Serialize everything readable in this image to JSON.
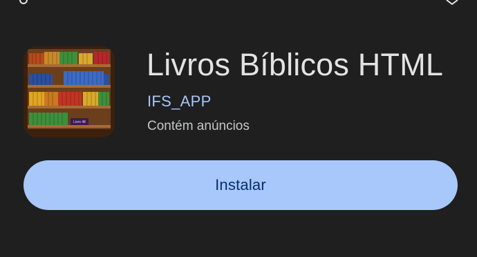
{
  "app": {
    "title": "Livros Bíblicos HTML",
    "developer": "IFS_APP",
    "ads_notice": "Contém anúncios",
    "icon_badge": "Livro 48"
  },
  "actions": {
    "install_label": "Instalar"
  },
  "colors": {
    "background": "#1f1f1f",
    "title_text": "#e3e3e3",
    "developer_link": "#a8c7fa",
    "secondary_text": "#c4c7c5",
    "button_fill": "#a8c7fa",
    "button_text": "#062e6f"
  },
  "icons": {
    "app_icon": "bookshelf-icon",
    "status_left": "status-glyph-icon",
    "status_right": "status-glyph-icon"
  }
}
